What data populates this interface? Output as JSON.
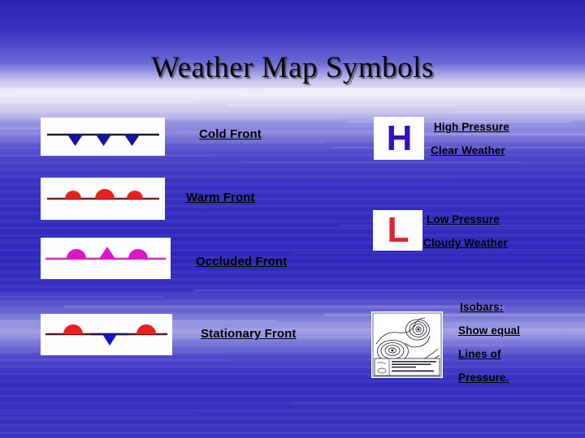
{
  "slide": {
    "title": "Weather Map Symbols",
    "background": {
      "sky_top_color": "#2a23b4",
      "horizon_color": "#e9e8f6",
      "water_color": "#332cbe"
    }
  },
  "fronts": [
    {
      "id": "cold-front",
      "label": "Cold Front",
      "line_color": "#1a1a2e",
      "marker_color": "#1414a0",
      "marker_shape": "triangle",
      "marker_side": "below"
    },
    {
      "id": "warm-front",
      "label": "Warm Front",
      "line_color": "#7a2020",
      "marker_color": "#e8221f",
      "marker_shape": "semicircle",
      "marker_side": "above"
    },
    {
      "id": "occluded-front",
      "label": "Occluded Front",
      "line_color": "#d22ac0",
      "marker_color": "#e015c8",
      "marker_shape": "semicircle-and-triangle",
      "marker_side": "above"
    },
    {
      "id": "stationary-front",
      "label": "Stationary Front",
      "line_color": "#5a1a1a",
      "marker_color": "#e8221f",
      "marker_color_alt": "#1414cc",
      "marker_shape": "semicircle-and-triangle",
      "marker_side": "both"
    }
  ],
  "pressure": {
    "high": {
      "symbol": "H",
      "symbol_color": "#3311bb",
      "lines": [
        "High Pressure",
        "Clear Weather"
      ]
    },
    "low": {
      "symbol": "L",
      "symbol_color": "#e02233",
      "lines": [
        "Low Pressure",
        "Cloudy Weather"
      ]
    }
  },
  "isobars": {
    "lines": [
      "Isobars:",
      "Show equal",
      "Lines  of",
      "Pressure."
    ],
    "diagram_caption": "isobar contour map with legend"
  }
}
